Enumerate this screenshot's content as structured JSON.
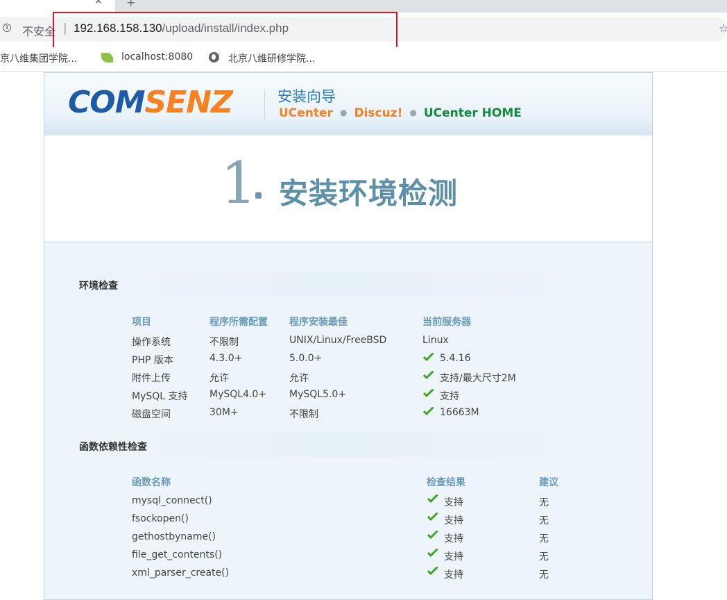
{
  "browser": {
    "address": {
      "security_label": "不安全",
      "separator": "|",
      "url_host": "192.168.158.130",
      "url_path": "/upload/install/index.php"
    },
    "bookmarks": [
      "京八维集团学院...",
      "localhost:8080",
      "北京八维研修学院..."
    ]
  },
  "header": {
    "logo_part1": "COM",
    "logo_part2": "SENZ",
    "wizard_title": "安装向导",
    "products": [
      "UCenter",
      "Discuz!",
      "UCenter HOME"
    ]
  },
  "step": {
    "number": "1",
    "title": "安装环境检测"
  },
  "env_check": {
    "title": "环境检查",
    "headers": [
      "项目",
      "程序所需配置",
      "程序安装最佳",
      "当前服务器"
    ],
    "rows": [
      {
        "item": "操作系统",
        "required": "不限制",
        "best": "UNIX/Linux/FreeBSD",
        "current": "Linux",
        "ok": false
      },
      {
        "item": "PHP 版本",
        "required": "4.3.0+",
        "best": "5.0.0+",
        "current": "5.4.16",
        "ok": true
      },
      {
        "item": "附件上传",
        "required": "允许",
        "best": "允许",
        "current": "支持/最大尺寸2M",
        "ok": true
      },
      {
        "item": "MySQL 支持",
        "required": "MySQL4.0+",
        "best": "MySQL5.0+",
        "current": "支持",
        "ok": true
      },
      {
        "item": "磁盘空间",
        "required": "30M+",
        "best": "不限制",
        "current": "16663M",
        "ok": true
      }
    ]
  },
  "func_check": {
    "title": "函数依赖性检查",
    "headers": [
      "函数名称",
      "检查结果",
      "建议"
    ],
    "rows": [
      {
        "name": "mysql_connect()",
        "result": "支持",
        "advice": "无"
      },
      {
        "name": "fsockopen()",
        "result": "支持",
        "advice": "无"
      },
      {
        "name": "gethostbyname()",
        "result": "支持",
        "advice": "无"
      },
      {
        "name": "file_get_contents()",
        "result": "支持",
        "advice": "无"
      },
      {
        "name": "xml_parser_create()",
        "result": "支持",
        "advice": "无"
      }
    ]
  },
  "colors": {
    "check_green": "#3aa61e",
    "header_blue": "#6a9bb8",
    "highlight_red": "#e0141a"
  }
}
